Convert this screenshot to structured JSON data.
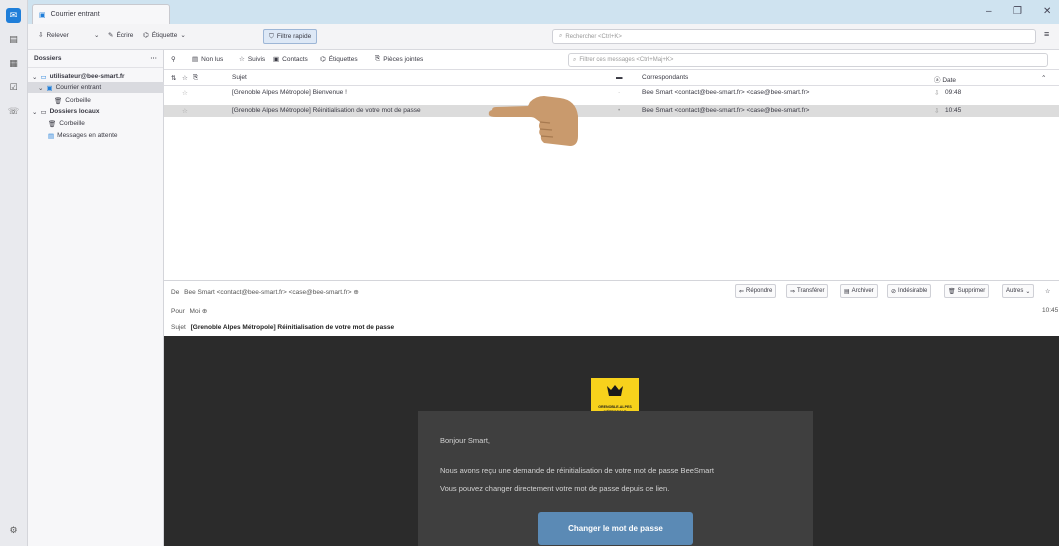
{
  "window": {
    "tab_title": "Courrier entrant",
    "controls": {
      "minimize": "–",
      "restore": "❐",
      "close": "✕"
    }
  },
  "toolbar": {
    "get_messages": "Relever",
    "write": "Écrire",
    "tag": "Étiquette",
    "quick_filter": "Filtre rapide",
    "search_placeholder": "Rechercher <Ctrl+K>"
  },
  "folder_pane": {
    "title": "Dossiers",
    "account": "utilisateur@bee-smart.fr",
    "inbox": "Courrier entrant",
    "trash": "Corbeille",
    "local_folders": "Dossiers locaux",
    "local_trash": "Corbeille",
    "outbox": "Messages en attente"
  },
  "message_list_toolbar": {
    "unread": "Non lus",
    "starred": "Suivis",
    "contacts": "Contacts",
    "tags": "Étiquettes",
    "attachments": "Pièces jointes",
    "filter_placeholder": "Filtrer ces messages <Ctrl+Maj+K>"
  },
  "columns": {
    "subject": "Sujet",
    "correspondents": "Correspondants",
    "date": "Date"
  },
  "messages": [
    {
      "subject": "[Grenoble Alpes Métropole] Bienvenue !",
      "correspondents": "Bee Smart <contact@bee-smart.fr> <case@bee-smart.fr>",
      "date": "09:48"
    },
    {
      "subject": "[Grenoble Alpes Métropole] Réinitialisation de votre mot de passe",
      "correspondents": "Bee Smart <contact@bee-smart.fr> <case@bee-smart.fr>",
      "date": "10:45"
    }
  ],
  "header_pane": {
    "from_label": "De",
    "from_value": "Bee Smart <contact@bee-smart.fr> <case@bee-smart.fr>",
    "to_label": "Pour",
    "to_value": "Moi",
    "subject_label": "Sujet",
    "subject_value": "[Grenoble Alpes Métropole] Réinitialisation de votre mot de passe",
    "time": "10:45",
    "actions": {
      "reply": "Répondre",
      "forward": "Transférer",
      "archive": "Archiver",
      "junk": "Indésirable",
      "delete": "Supprimer",
      "more": "Autres"
    }
  },
  "email_body": {
    "logo_text_line1": "GRENOBLE-ALPES",
    "logo_text_line2": "MÉTROPOLE",
    "greeting": "Bonjour Smart,",
    "line1": "Nous avons reçu une demande de réinitialisation de votre mot de passe BeeSmart",
    "line2": "Vous pouvez changer directement votre mot de passe depuis ce lien.",
    "cta": "Changer le mot de passe"
  },
  "colors": {
    "accent": "#5b8ab5",
    "logo_yellow": "#f7d21c",
    "body_dark": "#2b2b2b",
    "card": "#3f3f3f",
    "pointer_skin": "#c99a6d"
  }
}
